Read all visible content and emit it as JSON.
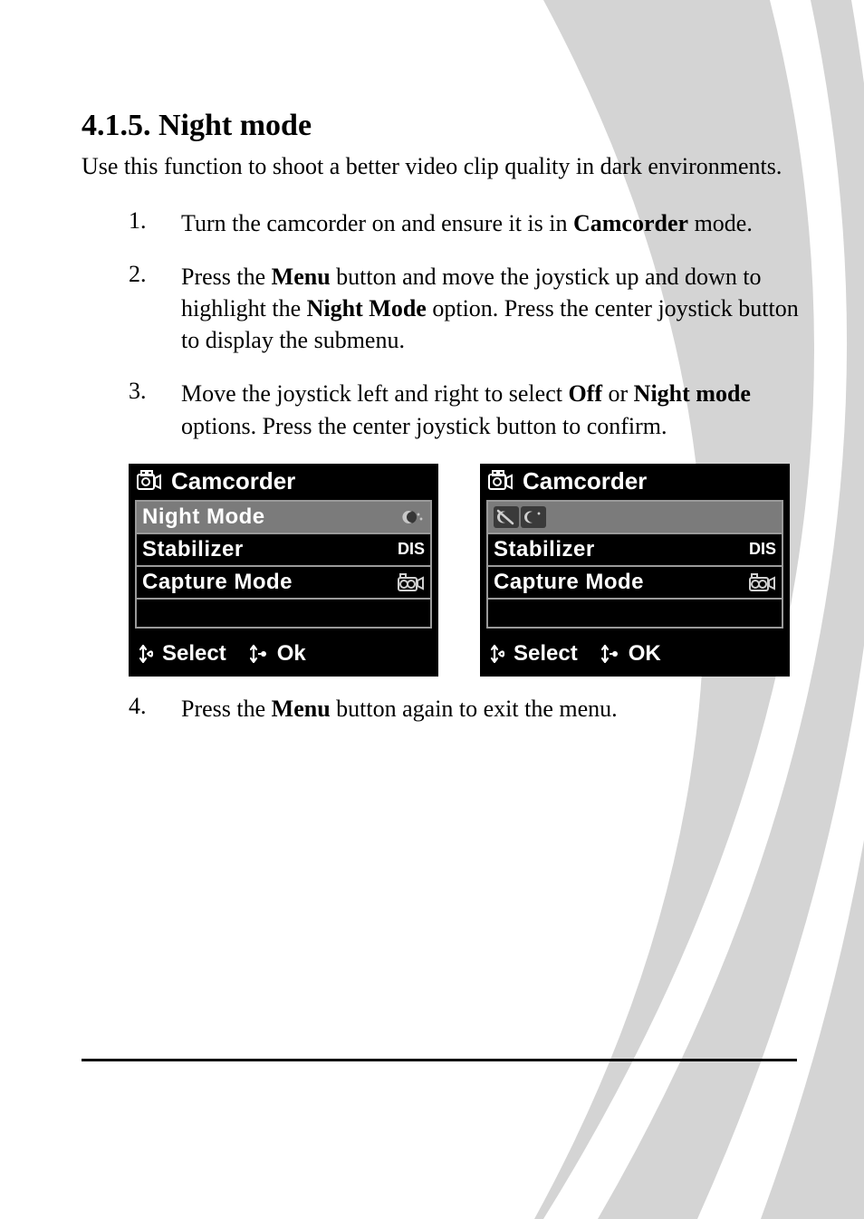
{
  "heading_num": "4.1.5.",
  "heading_title": "Night mode",
  "intro": "Use this function to shoot a better video clip quality in dark environments.",
  "steps": [
    {
      "num": "1.",
      "parts": [
        {
          "t": "Turn the camcorder on and ensure it is in "
        },
        {
          "t": "Camcorder",
          "b": true
        },
        {
          "t": " mode."
        }
      ]
    },
    {
      "num": "2.",
      "parts": [
        {
          "t": "Press the "
        },
        {
          "t": "Menu",
          "b": true
        },
        {
          "t": " button and move the joystick up and down to highlight the "
        },
        {
          "t": "Night Mode",
          "b": true
        },
        {
          "t": " option. Press the center joystick button to display the submenu."
        }
      ]
    },
    {
      "num": "3.",
      "parts": [
        {
          "t": "Move the joystick left and right to select "
        },
        {
          "t": "Off",
          "b": true
        },
        {
          "t": " or "
        },
        {
          "t": "Night mode",
          "b": true
        },
        {
          "t": " options. Press the center joystick button to confirm."
        }
      ]
    }
  ],
  "step4": {
    "num": "4.",
    "parts": [
      {
        "t": "Press the "
      },
      {
        "t": "Menu",
        "b": true
      },
      {
        "t": " button again to exit the menu."
      }
    ]
  },
  "screen_left": {
    "title": "Camcorder",
    "rows": [
      {
        "label": "Night Mode",
        "right_type": "night-icon",
        "highlight": true
      },
      {
        "label": "Stabilizer",
        "right_type": "text",
        "right_text": "DIS",
        "highlight": false
      },
      {
        "label": "Capture Mode",
        "right_type": "capture-icon",
        "highlight": false
      },
      {
        "label": "",
        "right_type": "none",
        "highlight": false
      }
    ],
    "footer": {
      "select": "Select",
      "ok": "Ok"
    }
  },
  "screen_right": {
    "title": "Camcorder",
    "rows": [
      {
        "label": "",
        "right_type": "night-pair",
        "highlight": true
      },
      {
        "label": "Stabilizer",
        "right_type": "text",
        "right_text": "DIS",
        "highlight": false
      },
      {
        "label": "Capture Mode",
        "right_type": "capture-icon",
        "highlight": false
      },
      {
        "label": "",
        "right_type": "none",
        "highlight": false
      }
    ],
    "footer": {
      "select": "Select",
      "ok": "OK"
    }
  }
}
